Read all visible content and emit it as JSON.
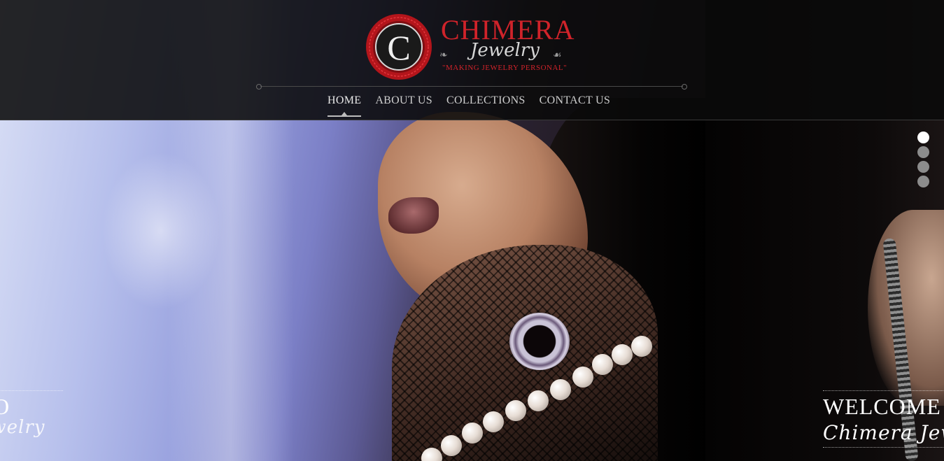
{
  "brand": {
    "logo_letter": "C",
    "name": "CHIMERA",
    "script": "Jewelry",
    "tagline": "\"MAKING JEWELRY PERSONAL\"",
    "colors": {
      "accent": "#d0232a",
      "header_bg": "#0a0a0a",
      "text": "#cfcfcf"
    }
  },
  "nav": {
    "items": [
      {
        "label": "HOME",
        "active": true
      },
      {
        "label": "ABOUT US",
        "active": false
      },
      {
        "label": "COLLECTIONS",
        "active": false
      },
      {
        "label": "CONTACT US",
        "active": false
      }
    ]
  },
  "slider": {
    "dot_count": 4,
    "active_index": 0,
    "left_caption": {
      "title": "TO",
      "subtitle": "ewelry"
    },
    "right_caption": {
      "title": "WELCOME",
      "subtitle": "Chimera Jewelry"
    }
  }
}
